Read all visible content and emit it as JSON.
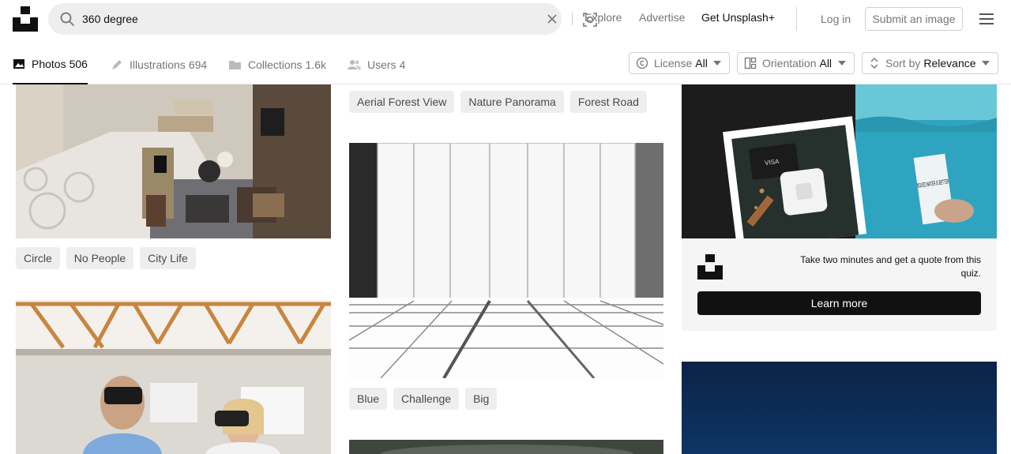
{
  "search": {
    "query": "360 degree"
  },
  "header": {
    "explore": "Explore",
    "advertise": "Advertise",
    "get_plus": "Get Unsplash+",
    "login": "Log in",
    "submit": "Submit an image"
  },
  "tabs": [
    {
      "label": "Photos",
      "count": "506"
    },
    {
      "label": "Illustrations",
      "count": "694"
    },
    {
      "label": "Collections",
      "count": "1.6k"
    },
    {
      "label": "Users",
      "count": "4"
    }
  ],
  "filters": [
    {
      "label": "License",
      "value": "All"
    },
    {
      "label": "Orientation",
      "value": "All"
    },
    {
      "label": "Sort by",
      "value": "Relevance"
    }
  ],
  "col1": {
    "tags": [
      "Circle",
      "No People",
      "City Life"
    ]
  },
  "col2": {
    "tags_top": [
      "Aerial Forest View",
      "Nature Panorama",
      "Forest Road"
    ],
    "tags_mid": [
      "Blue",
      "Challenge",
      "Big"
    ]
  },
  "ad": {
    "card_text": "VISA",
    "carton_text": "BOXED WATER IS BETTER",
    "text": "Take two minutes and get a quote from this quiz.",
    "button": "Learn more"
  },
  "colors": {
    "accent": "#111111",
    "tag_bg": "#eeeeee",
    "muted": "#767676"
  }
}
